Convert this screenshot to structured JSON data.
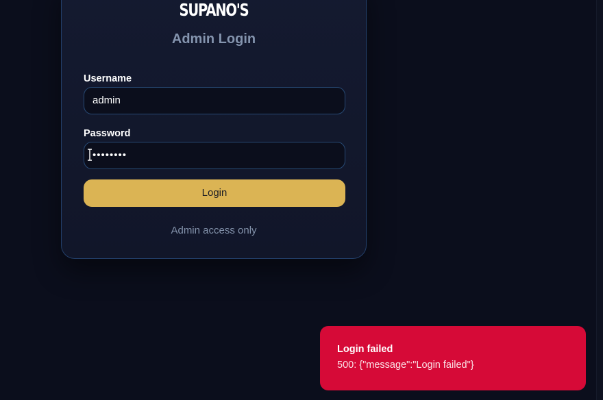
{
  "brand": "SUPANO'S",
  "title": "Admin Login",
  "form": {
    "username_label": "Username",
    "username_value": "admin",
    "password_label": "Password",
    "password_value": "••••••••",
    "submit_label": "Login",
    "footnote": "Admin access only"
  },
  "toast": {
    "title": "Login failed",
    "message": "500: {\"message\":\"Login failed\"}"
  },
  "colors": {
    "background": "#0b0e1c",
    "card": "#141a30",
    "accent": "#dbb454",
    "error": "#d60a37",
    "border": "#274a75"
  }
}
